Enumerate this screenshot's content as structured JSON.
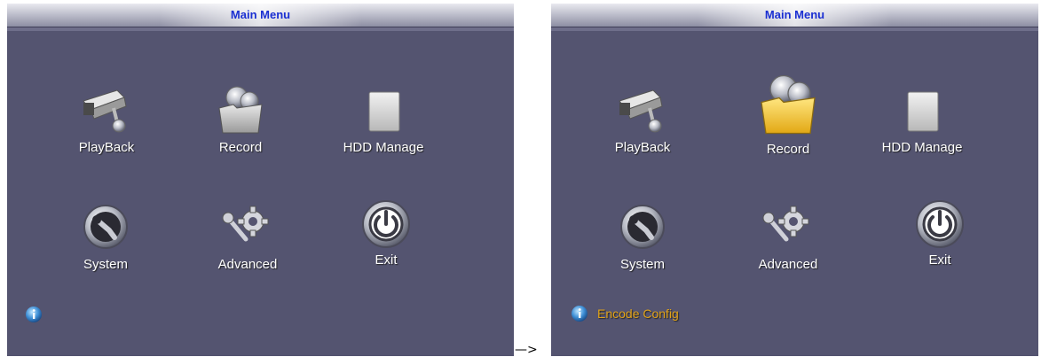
{
  "left": {
    "title": "Main Menu",
    "items": [
      {
        "label": "PlayBack",
        "icon": "camera-icon"
      },
      {
        "label": "Record",
        "icon": "record-folder-icon"
      },
      {
        "label": "HDD Manage",
        "icon": "hdd-icon"
      },
      {
        "label": "System",
        "icon": "wrench-icon"
      },
      {
        "label": "Advanced",
        "icon": "gear-wrench-icon"
      },
      {
        "label": "Exit",
        "icon": "power-icon"
      }
    ],
    "hint": ""
  },
  "right": {
    "title": "Main Menu",
    "items": [
      {
        "label": "PlayBack",
        "icon": "camera-icon"
      },
      {
        "label": "Record",
        "icon": "record-folder-icon",
        "selected": true
      },
      {
        "label": "HDD Manage",
        "icon": "hdd-icon"
      },
      {
        "label": "System",
        "icon": "wrench-icon"
      },
      {
        "label": "Advanced",
        "icon": "gear-wrench-icon"
      },
      {
        "label": "Exit",
        "icon": "power-icon"
      }
    ],
    "hint": "Encode Config"
  },
  "arrow": "—>",
  "colors": {
    "panel_bg": "#545470",
    "title_text": "#1a2fd2",
    "hint_text": "#e0a21a",
    "label_text": "#ffffff"
  }
}
